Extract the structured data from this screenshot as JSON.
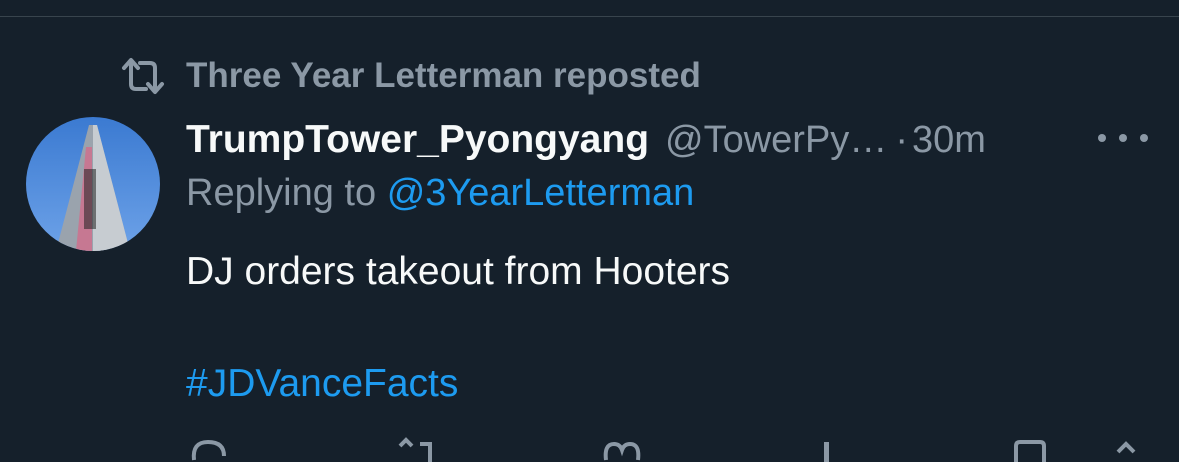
{
  "repost": {
    "icon": "repost-icon",
    "text": "Three Year Letterman reposted"
  },
  "tweet": {
    "avatar": "avatar",
    "display_name": "TrumpTower_Pyongyang",
    "handle": "@TowerPy…",
    "dot": "·",
    "time": "30m",
    "more_icon": "more-icon",
    "replying_to_label": "Replying to",
    "replying_to_handle": "@3YearLetterman",
    "text": "DJ orders takeout from Hooters",
    "hashtag": "#JDVanceFacts"
  },
  "colors": {
    "background": "#15202b",
    "primary_text": "#f7f9f9",
    "secondary_text": "#8b98a5",
    "accent": "#1d9bf0",
    "divider": "#38444d"
  },
  "actions": [
    "reply-icon",
    "retweet-icon",
    "like-icon",
    "views-icon",
    "bookmark-icon",
    "share-icon"
  ]
}
